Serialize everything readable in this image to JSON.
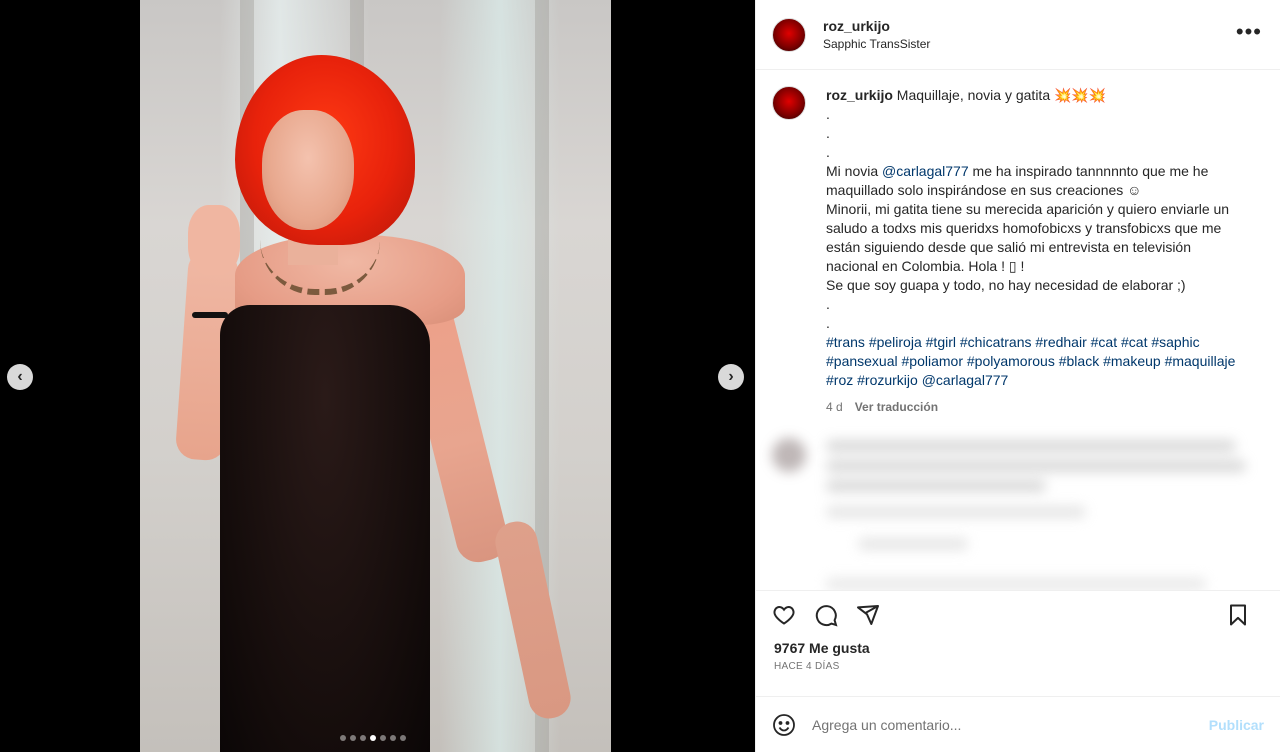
{
  "post": {
    "username": "roz_urkijo",
    "subtitle": "Sapphic TransSister",
    "more_icon": "more-horizontal-icon"
  },
  "media": {
    "slides_count": 7,
    "active_slide": 4,
    "prev_label": "‹",
    "next_label": "›"
  },
  "caption": {
    "username": "roz_urkijo",
    "title": "Maquillaje, novia y gatita 💥💥💥",
    "dots": ".\n.\n.",
    "line_1_pre": "Mi novia ",
    "mention_1": "@carlagal777",
    "line_1_post": " me ha inspirado tannnnnto que me he maquillado solo inspirándose en sus creaciones ☺",
    "paragraph_2": "Minorii, mi gatita tiene su merecida aparición y quiero enviarle un saludo a todxs mis queridxs homofobicxs y transfobicxs que me están siguiendo desde que salió mi entrevista en televisión nacional en Colombia. Hola ! ▯ !",
    "paragraph_3": "Se que soy guapa y todo, no hay necesidad de elaborar ;)",
    "dots_2": ".\n.",
    "hashtags": [
      "#trans",
      "#peliroja",
      "#tgirl",
      "#chicatrans",
      "#redhair",
      "#cat",
      "#cat",
      "#saphic",
      "#pansexual",
      "#poliamor",
      "#polyamorous",
      "#black",
      "#makeup",
      "#maquillaje",
      "#roz",
      "#rozurkijo"
    ],
    "mention_2": "@carlagal777",
    "age": "4 d",
    "translate_label": "Ver traducción"
  },
  "stats": {
    "likes": "9767 Me gusta",
    "date": "HACE 4 DÍAS"
  },
  "comment": {
    "placeholder": "Agrega un comentario...",
    "post_label": "Publicar"
  },
  "colors": {
    "link": "#00376b",
    "muted": "#737373",
    "publish_disabled": "#b2dffc"
  }
}
